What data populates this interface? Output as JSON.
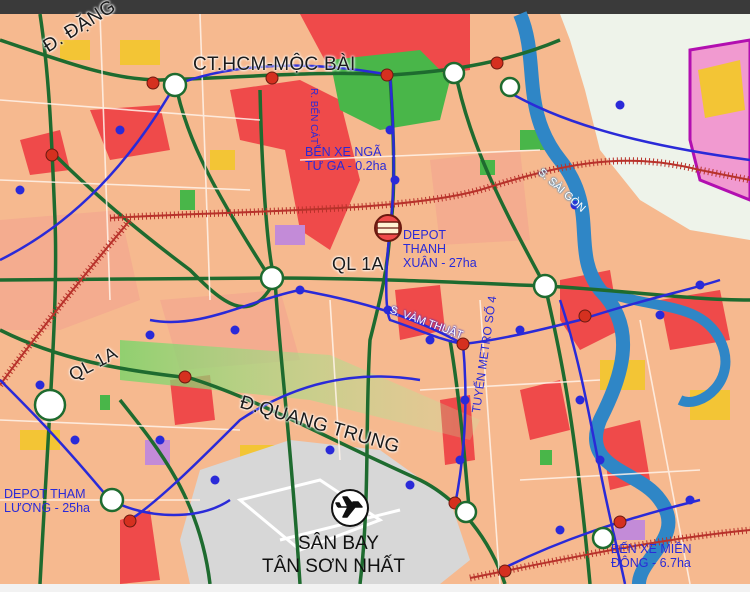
{
  "map": {
    "labels": {
      "road_dang": "Đ. ĐẶNG",
      "road_hcm_moc_bai": "CT.HCM-MỘC BÀI",
      "road_ben_cat": "R. BẾN CÁT",
      "ben_xe_nga_tu_ga": "BẾN XE NGÃ\nTƯ GA - 0.2ha",
      "depot_thanh_xuan": "DEPOT\nTHANH\nXUÂN - 27ha",
      "ql1a_center": "QL 1A",
      "ql1a_left": "QL 1A",
      "vam_thuat": "S. VÀM THUẬT",
      "tuyen_metro": "TUYẾN METRO SỐ 4",
      "song_sai_gon": "S. SÀI GÒN",
      "quang_trung": "Đ.QUANG TRUNG",
      "depot_tham_luong": "DEPOT THAM\nLƯƠNG - 25ha",
      "san_bay_line1": "SÂN BAY",
      "san_bay_line2": "TÂN SƠN NHẤT",
      "ben_xe_mien_dong": "BẾN XE MIỀN\nĐÔNG - 6.7ha"
    },
    "icons": [
      "airplane-icon",
      "depot-icon"
    ],
    "colors": {
      "residential": "#f6b98f",
      "mixed_use": "#ef4a4a",
      "park": "#49b649",
      "water": "#2f86c6",
      "road_major": "#1e6b2f",
      "metro_line": "#2a2ad8",
      "railway": "#b8322b",
      "airport": "#d7d7d7",
      "commercial": "#f3c535",
      "public": "#c38bd8"
    }
  }
}
